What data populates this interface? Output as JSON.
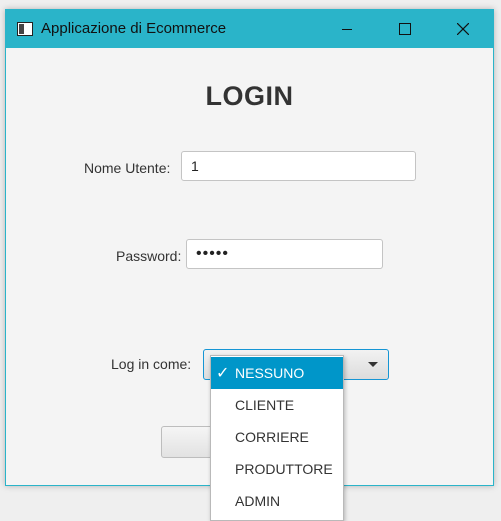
{
  "window": {
    "title": "Applicazione di Ecommerce",
    "titlebar_color": "#2ab4c9",
    "icon": "app-window-icon"
  },
  "form": {
    "heading": "LOGIN",
    "username_label": "Nome Utente:",
    "username_value": "1",
    "password_label": "Password:",
    "password_value": "•••••",
    "role_label": "Log in come:",
    "role_selected": "NESSUNO"
  },
  "dropdown": {
    "options": [
      "NESSUNO",
      "CLIENTE",
      "CORRIERE",
      "PRODUTTORE",
      "ADMIN"
    ],
    "selected_index": 0,
    "highlight_color": "#0096c9",
    "check_mark": "✓"
  }
}
